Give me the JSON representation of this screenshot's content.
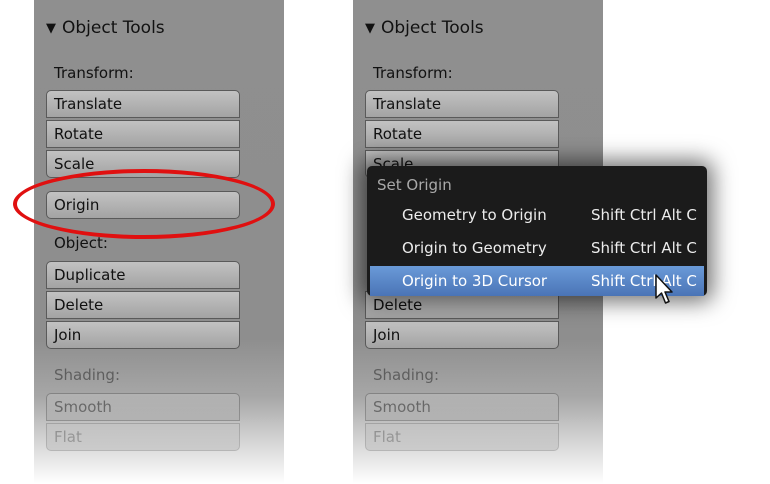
{
  "left_panel": {
    "header": "Object Tools",
    "transform_label": "Transform:",
    "transform_buttons": [
      "Translate",
      "Rotate",
      "Scale"
    ],
    "origin_button": "Origin",
    "object_label": "Object:",
    "object_buttons": [
      "Duplicate",
      "Delete",
      "Join"
    ],
    "shading_label": "Shading:",
    "shading_buttons": [
      "Smooth",
      "Flat"
    ]
  },
  "right_panel": {
    "header": "Object Tools",
    "transform_label": "Transform:",
    "transform_buttons": [
      "Translate",
      "Rotate",
      "Scale"
    ],
    "object_buttons": [
      "Delete",
      "Join"
    ],
    "shading_label": "Shading:",
    "shading_buttons": [
      "Smooth",
      "Flat"
    ]
  },
  "menu": {
    "title": "Set Origin",
    "items": [
      {
        "label": "Geometry to Origin",
        "shortcut": "Shift Ctrl Alt C"
      },
      {
        "label": "Origin to Geometry",
        "shortcut": "Shift Ctrl Alt C"
      },
      {
        "label": "Origin to 3D Cursor",
        "shortcut": "Shift Ctrl Alt C"
      }
    ],
    "active_index": 2
  },
  "colors": {
    "highlight_ellipse": "#e01010",
    "menu_bg": "#1b1b1b",
    "menu_active": "#5a86c8"
  },
  "icons": [
    "triangle-down-icon",
    "mouse-pointer-icon"
  ]
}
